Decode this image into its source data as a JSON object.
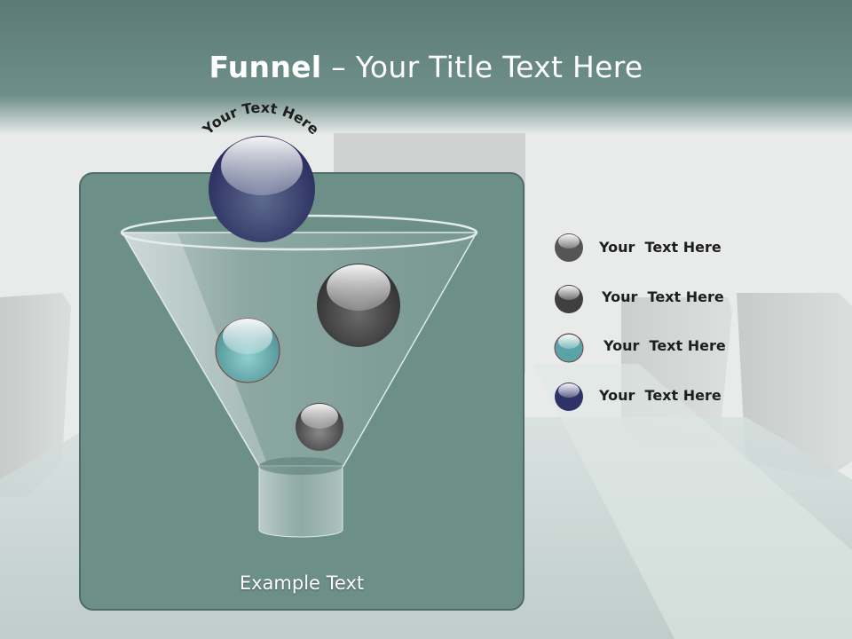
{
  "slide": {
    "title_bold": "Funnel",
    "title_rest": " – Your Title Text Here",
    "arc_text": "Your Text Here",
    "panel_caption": "Example Text"
  },
  "legend": [
    {
      "label": "Your  Text Here",
      "color": "#6e6e6e"
    },
    {
      "label": "Your  Text Here",
      "color": "#5a5a5a"
    },
    {
      "label": "Your  Text Here",
      "color": "#6fb3b3"
    },
    {
      "label": "Your  Text Here",
      "color": "#3c3f66"
    }
  ],
  "colors": {
    "header": "#5d7c77",
    "panel": "#6c8f88",
    "panel_border": "#4f6d68"
  }
}
